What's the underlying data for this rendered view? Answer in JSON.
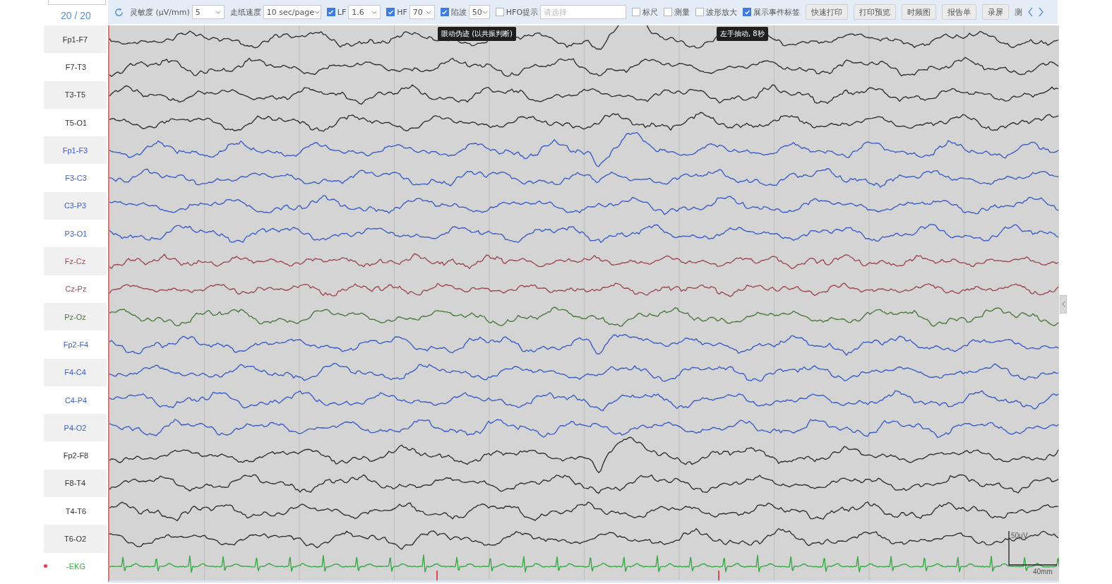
{
  "page_counter": "20 / 20",
  "toolbar": {
    "controls": [
      {
        "kind": "select",
        "label": "灵敏度 (μV/mm)",
        "value": "5"
      },
      {
        "kind": "select",
        "label": "走纸速度",
        "value": "10 sec/page"
      },
      {
        "kind": "check-select",
        "label": "LF",
        "checked": true,
        "value": "1.6"
      },
      {
        "kind": "check-select",
        "label": "HF",
        "checked": true,
        "value": "70"
      },
      {
        "kind": "check-select",
        "label": "陷波",
        "checked": true,
        "value": "50"
      },
      {
        "kind": "check-input",
        "label": "HFO提示",
        "checked": false,
        "placeholder": "请选择"
      },
      {
        "kind": "check",
        "label": "标尺",
        "checked": false
      },
      {
        "kind": "check",
        "label": "测量",
        "checked": false
      },
      {
        "kind": "check",
        "label": "波形放大",
        "checked": false
      },
      {
        "kind": "check",
        "label": "展示事件标签",
        "checked": true
      },
      {
        "kind": "button",
        "label": "快速打印"
      },
      {
        "kind": "button",
        "label": "打印预览"
      },
      {
        "kind": "button",
        "label": "时频图"
      },
      {
        "kind": "button",
        "label": "报告单"
      },
      {
        "kind": "button",
        "label": "录屏"
      },
      {
        "kind": "label",
        "label": "测"
      }
    ]
  },
  "events": [
    {
      "label": "眼动伪迹 (以共振判断)"
    },
    {
      "label": "左手抽动, 8秒"
    }
  ],
  "channels": [
    {
      "name": "Fp1-F7",
      "kind": "eeg",
      "color": "#333333",
      "flagged": false
    },
    {
      "name": "F7-T3",
      "kind": "eeg",
      "color": "#333333",
      "flagged": false
    },
    {
      "name": "T3-T5",
      "kind": "eeg",
      "color": "#333333",
      "flagged": false
    },
    {
      "name": "T5-O1",
      "kind": "eeg",
      "color": "#333333",
      "flagged": false
    },
    {
      "name": "Fp1-F3",
      "kind": "eeg",
      "color": "#3c5fc6",
      "flagged": false
    },
    {
      "name": "F3-C3",
      "kind": "eeg",
      "color": "#3c5fc6",
      "flagged": false
    },
    {
      "name": "C3-P3",
      "kind": "eeg",
      "color": "#3c5fc6",
      "flagged": false
    },
    {
      "name": "P3-O1",
      "kind": "eeg",
      "color": "#3c5fc6",
      "flagged": false
    },
    {
      "name": "Fz-Cz",
      "kind": "eeg",
      "color": "#9c4a55",
      "flagged": false
    },
    {
      "name": "Cz-Pz",
      "kind": "eeg",
      "color": "#9c4a55",
      "flagged": false
    },
    {
      "name": "Pz-Oz",
      "kind": "eeg",
      "color": "#4b7a3c",
      "flagged": false
    },
    {
      "name": "Fp2-F4",
      "kind": "eeg",
      "color": "#3c5fc6",
      "flagged": false
    },
    {
      "name": "F4-C4",
      "kind": "eeg",
      "color": "#3c5fc6",
      "flagged": false
    },
    {
      "name": "C4-P4",
      "kind": "eeg",
      "color": "#3c5fc6",
      "flagged": false
    },
    {
      "name": "P4-O2",
      "kind": "eeg",
      "color": "#3c5fc6",
      "flagged": false
    },
    {
      "name": "Fp2-F8",
      "kind": "eeg",
      "color": "#333333",
      "flagged": false
    },
    {
      "name": "F8-T4",
      "kind": "eeg",
      "color": "#333333",
      "flagged": false
    },
    {
      "name": "T4-T6",
      "kind": "eeg",
      "color": "#333333",
      "flagged": false
    },
    {
      "name": "T6-O2",
      "kind": "eeg",
      "color": "#333333",
      "flagged": false
    },
    {
      "name": "-EKG",
      "kind": "ekg",
      "color": "#3aa845",
      "flagged": true
    }
  ],
  "scale_bar": {
    "amplitude": "50μV",
    "time": "40mm"
  }
}
